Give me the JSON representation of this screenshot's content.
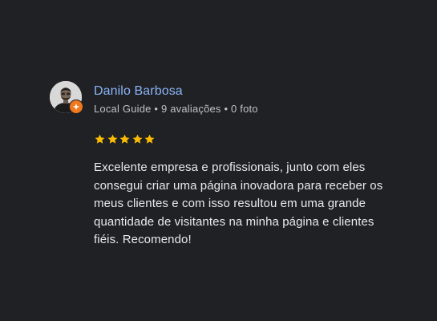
{
  "review": {
    "author_name": "Danilo Barbosa",
    "author_role": "Local Guide",
    "review_count": "9 avaliações",
    "photo_count": "0 foto",
    "separator": " • ",
    "rating": 5,
    "rating_max": 5,
    "text": "Excelente empresa e profissionais, junto com eles consegui criar uma página inovadora para receber os meus clientes e com isso resultou em uma grande quantidade de visitantes na minha página e clientes fiéis. Recomendo!",
    "icons": {
      "avatar": "avatar-photo",
      "badge": "local-guide-badge-icon",
      "star": "star-icon"
    },
    "colors": {
      "background": "#202124",
      "name": "#8ab4f8",
      "meta": "#bdc1c6",
      "text": "#e8eaed",
      "star": "#fbbc04",
      "badge": "#f1781d"
    }
  }
}
